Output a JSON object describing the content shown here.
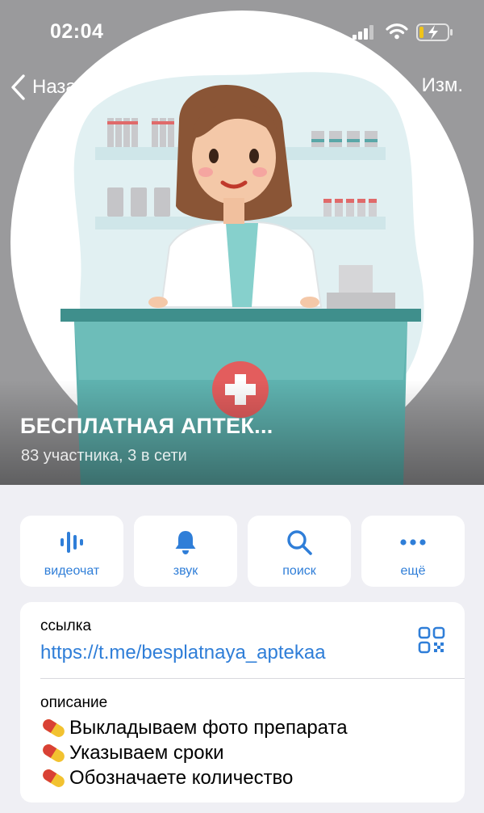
{
  "status_bar": {
    "time": "02:04"
  },
  "nav": {
    "back_label": "Назад",
    "edit_label": "Изм."
  },
  "group": {
    "name": "БЕСПЛАТНАЯ АПТЕК...",
    "subtitle": "83 участника, 3 в сети"
  },
  "actions": [
    {
      "label": "видеочат",
      "icon": "voice-chat-icon"
    },
    {
      "label": "звук",
      "icon": "bell-icon"
    },
    {
      "label": "поиск",
      "icon": "search-icon"
    },
    {
      "label": "ещё",
      "icon": "more-icon"
    }
  ],
  "info": {
    "link_label": "ссылка",
    "link_value": "https://t.me/besplatnaya_aptekaa",
    "description_label": "описание",
    "description_lines": [
      "Выкладываем фото препарата",
      "Указываем сроки",
      "Обозначаете количество"
    ]
  },
  "colors": {
    "accent": "#2f7ed8",
    "background": "#efeff4",
    "card": "#ffffff"
  }
}
